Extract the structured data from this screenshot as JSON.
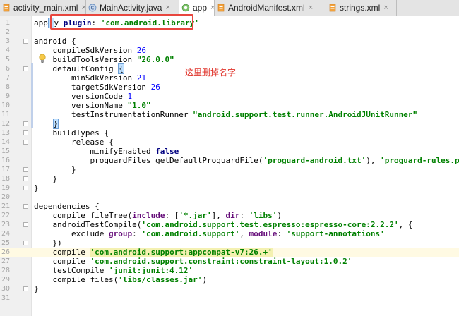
{
  "tabs": [
    {
      "label": "activity_main.xml",
      "icon": "xml-file-icon",
      "close": "×",
      "active": false
    },
    {
      "label": "MainActivity.java",
      "icon": "java-class-icon",
      "close": "×",
      "active": false
    },
    {
      "label": "app",
      "icon": "gradle-icon",
      "close": "×",
      "active": true
    },
    {
      "label": "AndroidManifest.xml",
      "icon": "xml-file-icon",
      "close": "×",
      "active": false
    },
    {
      "label": "strings.xml",
      "icon": "xml-file-icon",
      "close": "×",
      "active": false
    }
  ],
  "editor": {
    "annotation": "这里删掉名字",
    "annotation_color": "#e0332a",
    "line_numbers": [
      "1",
      "2",
      "3",
      "4",
      "5",
      "6",
      "7",
      "8",
      "9",
      "10",
      "11",
      "12",
      "13",
      "14",
      "15",
      "16",
      "17",
      "18",
      "19",
      "20",
      "21",
      "22",
      "23",
      "24",
      "25",
      "26",
      "27",
      "28",
      "29",
      "30",
      "31"
    ],
    "lines": [
      {
        "segs": [
          [
            "t",
            "app"
          ],
          [
            "cur",
            "l"
          ],
          [
            "t",
            "y "
          ],
          [
            "kw",
            "plugin"
          ],
          [
            "t",
            ": "
          ],
          [
            "str",
            "'com.android.library'"
          ]
        ]
      },
      {
        "segs": []
      },
      {
        "segs": [
          [
            "t",
            "android {"
          ]
        ],
        "fold": true
      },
      {
        "segs": [
          [
            "t",
            "    compileSdkVersion "
          ],
          [
            "num",
            "26"
          ]
        ]
      },
      {
        "segs": [
          [
            "t",
            "    buildToolsVersion "
          ],
          [
            "str",
            "\"26.0.0\""
          ]
        ]
      },
      {
        "segs": [
          [
            "t",
            "    defaultConfig "
          ],
          [
            "cur",
            "{"
          ]
        ],
        "fold": true
      },
      {
        "segs": [
          [
            "t",
            "        minSdkVersion "
          ],
          [
            "num",
            "21"
          ]
        ]
      },
      {
        "segs": [
          [
            "t",
            "        targetSdkVersion "
          ],
          [
            "num",
            "26"
          ]
        ]
      },
      {
        "segs": [
          [
            "t",
            "        versionCode "
          ],
          [
            "num",
            "1"
          ]
        ]
      },
      {
        "segs": [
          [
            "t",
            "        versionName "
          ],
          [
            "str",
            "\"1.0\""
          ]
        ]
      },
      {
        "segs": [
          [
            "t",
            "        testInstrumentationRunner "
          ],
          [
            "str",
            "\"android.support.test.runner.AndroidJUnitRunner\""
          ]
        ]
      },
      {
        "segs": [
          [
            "t",
            "    "
          ],
          [
            "cur",
            "}"
          ]
        ],
        "fold": true
      },
      {
        "segs": [
          [
            "t",
            "    buildTypes {"
          ]
        ],
        "fold": true
      },
      {
        "segs": [
          [
            "t",
            "        release {"
          ]
        ],
        "fold": true
      },
      {
        "segs": [
          [
            "t",
            "            minifyEnabled "
          ],
          [
            "kw",
            "false"
          ]
        ]
      },
      {
        "segs": [
          [
            "t",
            "            proguardFiles getDefaultProguardFile("
          ],
          [
            "str",
            "'proguard-android.txt'"
          ],
          [
            "t",
            "), "
          ],
          [
            "str",
            "'proguard-rules.pro'"
          ]
        ]
      },
      {
        "segs": [
          [
            "t",
            "        }"
          ]
        ],
        "fold": true
      },
      {
        "segs": [
          [
            "t",
            "    }"
          ]
        ],
        "fold": true
      },
      {
        "segs": [
          [
            "t",
            "}"
          ]
        ],
        "fold": true
      },
      {
        "segs": []
      },
      {
        "segs": [
          [
            "t",
            "dependencies {"
          ]
        ],
        "fold": true
      },
      {
        "segs": [
          [
            "t",
            "    compile fileTree("
          ],
          [
            "nm",
            "include"
          ],
          [
            "t",
            ": ["
          ],
          [
            "str",
            "'*.jar'"
          ],
          [
            "t",
            "], "
          ],
          [
            "nm",
            "dir"
          ],
          [
            "t",
            ": "
          ],
          [
            "str",
            "'libs'"
          ],
          [
            "t",
            ")"
          ]
        ]
      },
      {
        "segs": [
          [
            "t",
            "    androidTestCompile("
          ],
          [
            "str",
            "'com.android.support.test.espresso:espresso-core:2.2.2'"
          ],
          [
            "t",
            ", {"
          ]
        ],
        "fold": true
      },
      {
        "segs": [
          [
            "t",
            "        exclude "
          ],
          [
            "nm",
            "group"
          ],
          [
            "t",
            ": "
          ],
          [
            "str",
            "'com.android.support'"
          ],
          [
            "t",
            ", "
          ],
          [
            "nm",
            "module"
          ],
          [
            "t",
            ": "
          ],
          [
            "str",
            "'support-annotations'"
          ]
        ]
      },
      {
        "segs": [
          [
            "t",
            "    })"
          ]
        ],
        "fold": true
      },
      {
        "segs": [
          [
            "t",
            "    compile "
          ],
          [
            "mark",
            "'com.android.support:appcompat-v7:26.+'"
          ]
        ],
        "hl": true
      },
      {
        "segs": [
          [
            "t",
            "    compile "
          ],
          [
            "str",
            "'com.android.support.constraint:constraint-layout:1.0.2'"
          ]
        ]
      },
      {
        "segs": [
          [
            "t",
            "    testCompile "
          ],
          [
            "str",
            "'junit:junit:4.12'"
          ]
        ]
      },
      {
        "segs": [
          [
            "t",
            "    compile files("
          ],
          [
            "str",
            "'libs/classes.jar'"
          ],
          [
            "t",
            ")"
          ]
        ]
      },
      {
        "segs": [
          [
            "t",
            "}"
          ]
        ],
        "fold": true
      },
      {
        "segs": []
      }
    ]
  },
  "colors": {
    "keyword": "#000080",
    "string": "#008000",
    "number": "#0000ff",
    "named_arg": "#660e7a",
    "highlight_box": "#e8463e",
    "gutter_bg": "#f0f0f0",
    "tab_bar_bg": "#e4e4e4"
  }
}
